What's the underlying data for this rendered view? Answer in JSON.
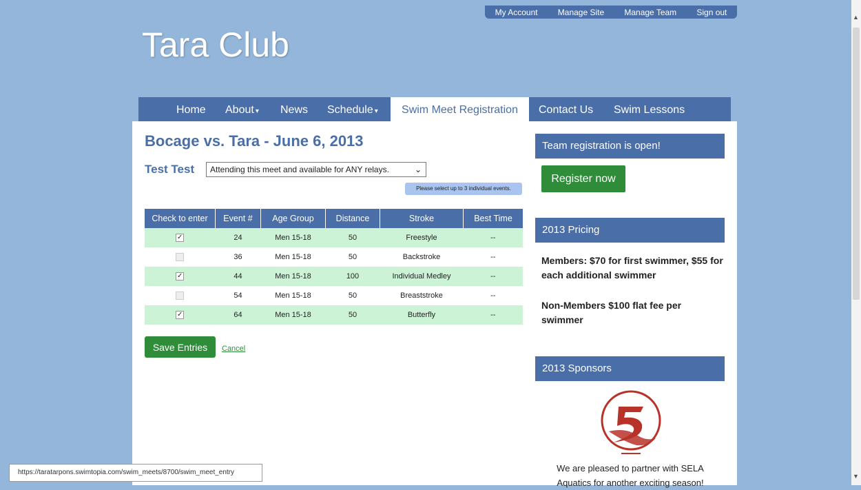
{
  "top_links": [
    "My Account",
    "Manage Site",
    "Manage Team",
    "Sign out"
  ],
  "site_title": "Tara Club",
  "nav": {
    "home": "Home",
    "about": "About",
    "news": "News",
    "schedule": "Schedule",
    "swim_meet": "Swim Meet Registration",
    "contact": "Contact Us",
    "lessons": "Swim Lessons"
  },
  "meet_title": "Bocage vs. Tara - June 6, 2013",
  "swimmer_name": "Test Test",
  "attendance_select": "Attending this meet and available for ANY relays.",
  "hint_text": "Please select up to 3 individual events.",
  "table": {
    "headers": [
      "Check to enter",
      "Event #",
      "Age Group",
      "Distance",
      "Stroke",
      "Best Time"
    ],
    "rows": [
      {
        "checked": true,
        "event": "24",
        "age": "Men 15-18",
        "distance": "50",
        "stroke": "Freestyle",
        "best": "--"
      },
      {
        "checked": false,
        "event": "36",
        "age": "Men 15-18",
        "distance": "50",
        "stroke": "Backstroke",
        "best": "--"
      },
      {
        "checked": true,
        "event": "44",
        "age": "Men 15-18",
        "distance": "100",
        "stroke": "Individual Medley",
        "best": "--"
      },
      {
        "checked": false,
        "event": "54",
        "age": "Men 15-18",
        "distance": "50",
        "stroke": "Breaststroke",
        "best": "--"
      },
      {
        "checked": true,
        "event": "64",
        "age": "Men 15-18",
        "distance": "50",
        "stroke": "Butterfly",
        "best": "--"
      }
    ]
  },
  "save_label": "Save Entries",
  "cancel_label": "Cancel",
  "sidebar": {
    "registration_head": "Team registration is open!",
    "register_btn": "Register now",
    "pricing_head": "2013 Pricing",
    "pricing_members": "Members: $70 for first swimmer, $55 for each additional swimmer",
    "pricing_nonmembers": "Non-Members $100 flat fee per swimmer",
    "sponsors_head": "2013 Sponsors",
    "sponsor_text": "We are pleased to partner with SELA Aquatics for another exciting season!"
  },
  "status_url": "https://taratarpons.swimtopia.com/swim_meets/8700/swim_meet_entry",
  "colors": {
    "background": "#93b6da",
    "nav": "#4a6ea8",
    "green": "#2f8d3a",
    "row_alt": "#cdf3d7",
    "logo_red": "#b8322a"
  }
}
